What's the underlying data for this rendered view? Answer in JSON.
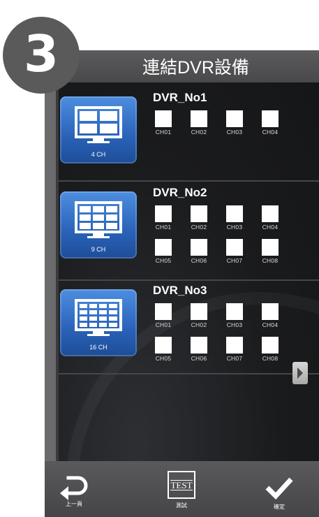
{
  "step": "3",
  "title": "連結DVR設備",
  "dvrs": [
    {
      "name": "DVR_No1",
      "icon_label": "4 CH",
      "channels": [
        "CH01",
        "CH02",
        "CH03",
        "CH04"
      ]
    },
    {
      "name": "DVR_No2",
      "icon_label": "9 CH",
      "channels": [
        "CH01",
        "CH02",
        "CH03",
        "CH04",
        "CH05",
        "CH06",
        "CH07",
        "CH08"
      ]
    },
    {
      "name": "DVR_No3",
      "icon_label": "16 CH",
      "channels": [
        "CH01",
        "CH02",
        "CH03",
        "CH04",
        "CH05",
        "CH06",
        "CH07",
        "CH08"
      ]
    }
  ],
  "bottom": {
    "back_label": "上一頁",
    "test_text": "TEST",
    "test_label": "測試",
    "confirm_label": "確定"
  },
  "icons": {
    "back": "back-arrow-icon",
    "test": "test-icon",
    "confirm": "checkmark-icon",
    "next": "chevron-right-icon"
  },
  "colors": {
    "title_bar": "#4f4f51",
    "content_bg": "#1c1d1f",
    "dvr_icon": "#2f6ac0",
    "checkbox": "#ffffff"
  }
}
